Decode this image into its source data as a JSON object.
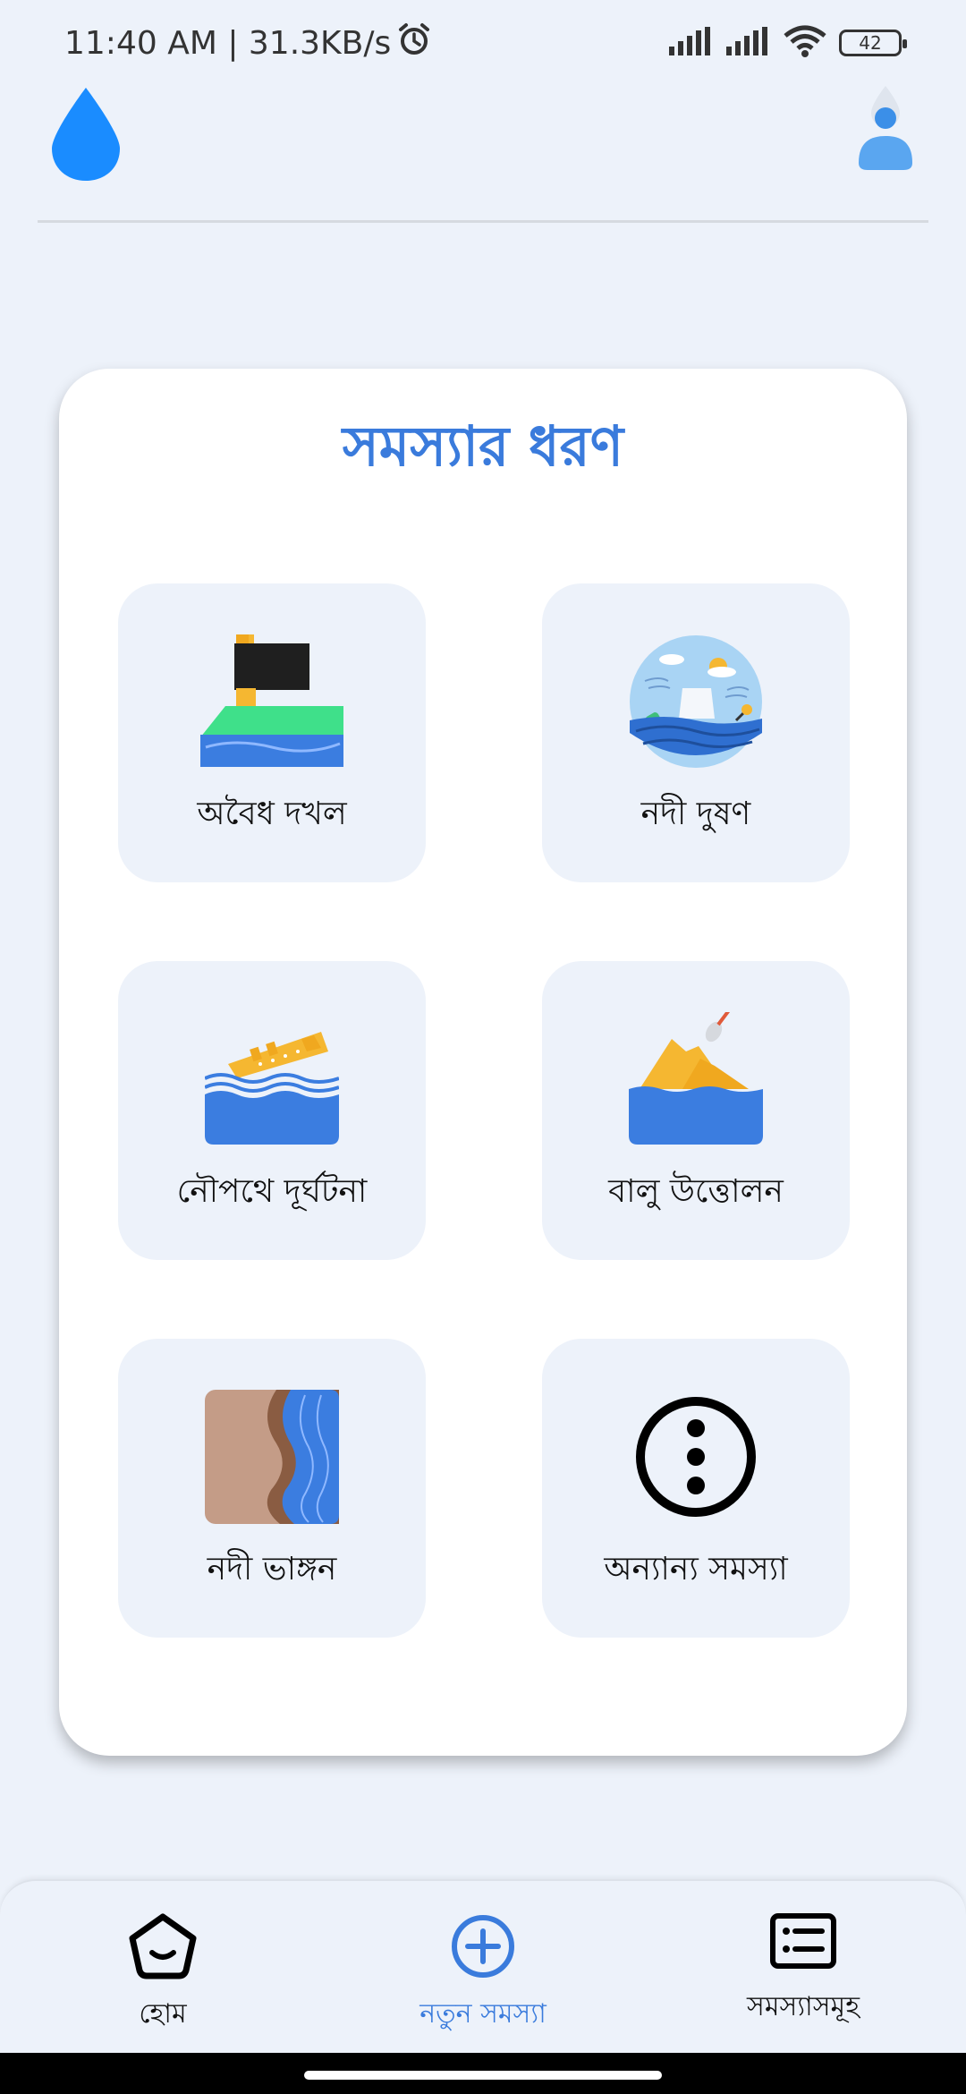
{
  "status_bar": {
    "time_speed": "11:40 AM | 31.3KB/s",
    "battery": "42"
  },
  "card": {
    "title": "সমস্যার ধরণ",
    "tiles": [
      {
        "label": "অবৈধ দখল",
        "icon": "encroachment-icon"
      },
      {
        "label": "নদী দুষণ",
        "icon": "river-pollution-icon"
      },
      {
        "label": "নৌপথে দূর্ঘটনা",
        "icon": "shipwreck-icon"
      },
      {
        "label": "বালু উত্তোলন",
        "icon": "sand-extraction-icon"
      },
      {
        "label": "নদী ভাঙ্গন",
        "icon": "riverbank-erosion-icon"
      },
      {
        "label": "অন্যান্য সমস্যা",
        "icon": "more-options-icon"
      }
    ]
  },
  "nav": {
    "home": "হোম",
    "new_issue": "নতুন সমস্যা",
    "issues": "সমস্যাসমূহ"
  },
  "colors": {
    "accent": "#3a7bdc",
    "background": "#edf2fa",
    "water_blue": "#3b7de0",
    "drop_blue": "#1a8cff"
  }
}
